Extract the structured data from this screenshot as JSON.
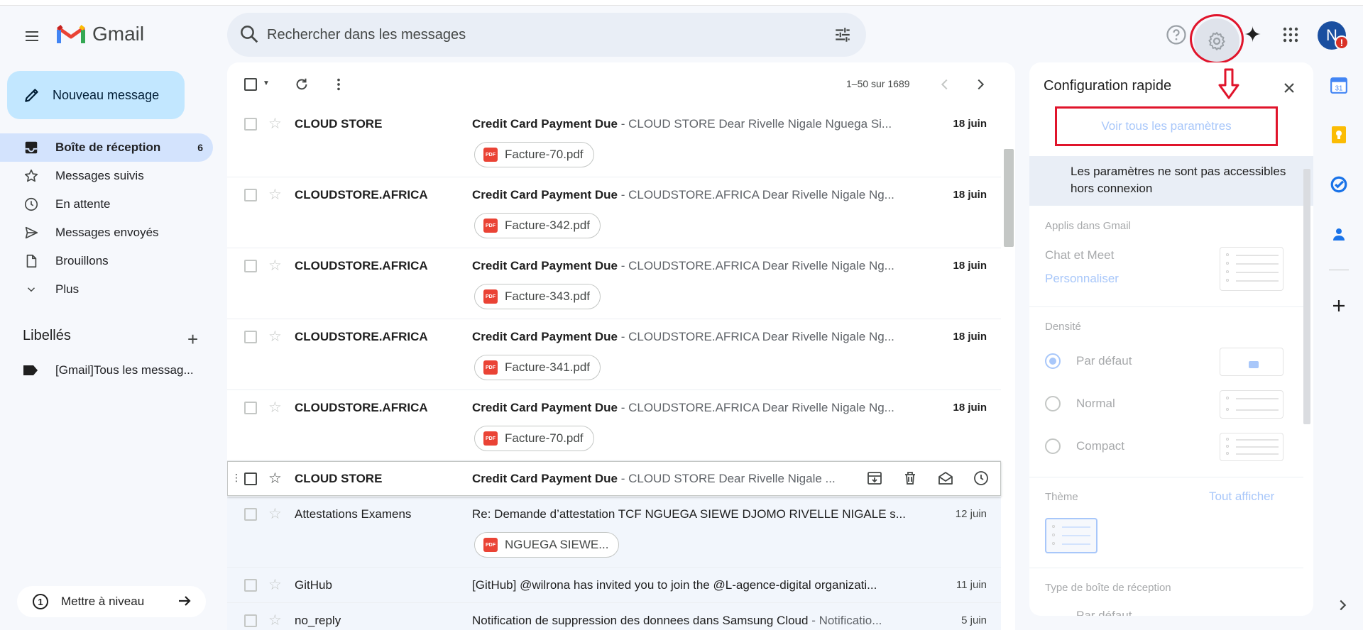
{
  "header": {
    "app_name": "Gmail",
    "search_placeholder": "Rechercher dans les messages",
    "avatar_letter": "N",
    "avatar_alert": "!"
  },
  "sidebar": {
    "compose_label": "Nouveau message",
    "items": [
      {
        "label": "Boîte de réception",
        "count": "6",
        "icon": "inbox-icon"
      },
      {
        "label": "Messages suivis",
        "count": "",
        "icon": "star-icon"
      },
      {
        "label": "En attente",
        "count": "",
        "icon": "clock-icon"
      },
      {
        "label": "Messages envoyés",
        "count": "",
        "icon": "send-icon"
      },
      {
        "label": "Brouillons",
        "count": "",
        "icon": "draft-icon"
      },
      {
        "label": "Plus",
        "count": "",
        "icon": "chevron-down-icon"
      }
    ],
    "labels_title": "Libellés",
    "labels_add": "+",
    "label_item": "[Gmail]Tous les messag...",
    "upgrade_label": "Mettre à niveau"
  },
  "toolbar": {
    "pager": "1–50 sur 1689"
  },
  "emails": [
    {
      "sender": "CLOUD STORE",
      "subject": "Credit Card Payment Due",
      "snippet": " - CLOUD STORE Dear Rivelle Nigale Nguega Si...",
      "date": "18 juin",
      "attachment": "Facture-70.pdf"
    },
    {
      "sender": "CLOUDSTORE.AFRICA",
      "subject": "Credit Card Payment Due",
      "snippet": " - CLOUDSTORE.AFRICA Dear Rivelle Nigale Ng...",
      "date": "18 juin",
      "attachment": "Facture-342.pdf"
    },
    {
      "sender": "CLOUDSTORE.AFRICA",
      "subject": "Credit Card Payment Due",
      "snippet": " - CLOUDSTORE.AFRICA Dear Rivelle Nigale Ng...",
      "date": "18 juin",
      "attachment": "Facture-343.pdf"
    },
    {
      "sender": "CLOUDSTORE.AFRICA",
      "subject": "Credit Card Payment Due",
      "snippet": " - CLOUDSTORE.AFRICA Dear Rivelle Nigale Ng...",
      "date": "18 juin",
      "attachment": "Facture-341.pdf"
    },
    {
      "sender": "CLOUDSTORE.AFRICA",
      "subject": "Credit Card Payment Due",
      "snippet": " - CLOUDSTORE.AFRICA Dear Rivelle Nigale Ng...",
      "date": "18 juin",
      "attachment": "Facture-70.pdf"
    },
    {
      "sender": "CLOUD STORE",
      "subject": "Credit Card Payment Due",
      "snippet": " - CLOUD STORE Dear Rivelle Nigale ...",
      "date": "",
      "attachment": ""
    },
    {
      "sender": "Attestations Examens",
      "subject": "Re: Demande d’attestation TCF NGUEGA SIEWE DJOMO RIVELLE NIGALE s...",
      "snippet": "",
      "date": "12 juin",
      "attachment": "NGUEGA SIEWE..."
    },
    {
      "sender": "GitHub",
      "subject": "[GitHub] @wilrona has invited you to join the @L-agence-digital organizati...",
      "snippet": "",
      "date": "11 juin",
      "attachment": ""
    },
    {
      "sender": "no_reply",
      "subject": "Notification de suppression des donnees dans Samsung Cloud",
      "snippet": " - Notificatio...",
      "date": "5 juin",
      "attachment": ""
    }
  ],
  "quick_settings": {
    "title": "Configuration rapide",
    "all_settings": "Voir tous les paramètres",
    "offline_note": "Les paramètres ne sont pas accessibles hors connexion",
    "apps_section": "Applis dans Gmail",
    "chat_meet": "Chat et Meet",
    "customize": "Personnaliser",
    "density_section": "Densité",
    "density_options": [
      "Par défaut",
      "Normal",
      "Compact"
    ],
    "density_selected": "Par défaut",
    "theme_section": "Thème",
    "theme_show_all": "Tout afficher",
    "inbox_type_section": "Type de boîte de réception",
    "inbox_type_value": "Par défaut"
  },
  "colors": {
    "accent_red": "#e0142b",
    "compose_bg": "#c2e7ff",
    "active_nav": "#d3e3fd"
  }
}
